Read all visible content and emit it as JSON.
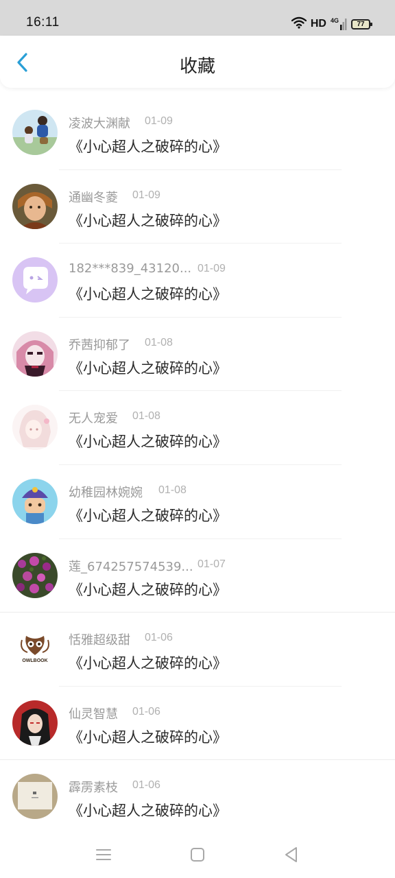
{
  "status_bar": {
    "time": "16:11",
    "network_type": "HD",
    "network_gen": "4G",
    "battery": "77",
    "icons": [
      "wifi-icon",
      "signal-icon",
      "battery-icon"
    ]
  },
  "header": {
    "title": "收藏",
    "back_icon": "chevron-left-icon",
    "accent_color": "#2a9fd6"
  },
  "favorites": [
    {
      "user": "凌波大渊献",
      "date": "01-09",
      "book": "《小心超人之破碎的心》"
    },
    {
      "user": "通幽冬菱",
      "date": "01-09",
      "book": "《小心超人之破碎的心》"
    },
    {
      "user": "182***839_43120...",
      "date": "01-09",
      "book": "《小心超人之破碎的心》"
    },
    {
      "user": "乔茜抑郁了",
      "date": "01-08",
      "book": "《小心超人之破碎的心》"
    },
    {
      "user": "无人宠爱",
      "date": "01-08",
      "book": "《小心超人之破碎的心》"
    },
    {
      "user": "幼稚园林婉婉",
      "date": "01-08",
      "book": "《小心超人之破碎的心》"
    },
    {
      "user": "莲_674257574539...",
      "date": "01-07",
      "book": "《小心超人之破碎的心》"
    },
    {
      "user": "恬雅超级甜",
      "date": "01-06",
      "book": "《小心超人之破碎的心》",
      "avatar_text": "OWLBOOK"
    },
    {
      "user": "仙灵智慧",
      "date": "01-06",
      "book": "《小心超人之破碎的心》"
    },
    {
      "user": "霹雳素枝",
      "date": "01-06",
      "book": "《小心超人之破碎的心》"
    }
  ],
  "nav_bar": {
    "icons": [
      "menu-icon",
      "home-square-icon",
      "back-triangle-icon"
    ]
  }
}
